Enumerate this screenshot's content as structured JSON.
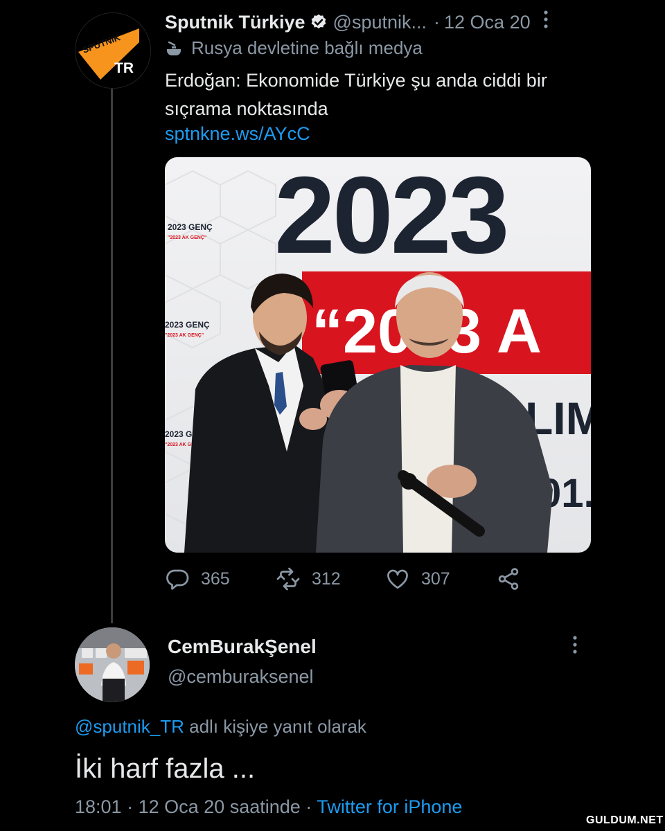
{
  "tweet": {
    "author_name": "Sputnik Türkiye",
    "handle": "@sputnik...",
    "separator": "·",
    "date": "12 Oca 20",
    "state_label": "Rusya devletine bağlı medya",
    "text": "Erdoğan: Ekonomide Türkiye şu anda ciddi bir sıçrama noktasında",
    "link": "sptnkne.ws/AYcC",
    "avatar": {
      "top_text": "SPUTNIK",
      "bottom_text": "TR",
      "accent": "#f7941d"
    },
    "image": {
      "banner_year": "2023",
      "banner_quote": "“2023 A",
      "banner_line3": "LIM",
      "banner_line4": "01.",
      "side_label_1": "2023 GENÇ",
      "side_label_2": "\"2023 AK GENÇ\"",
      "accent_red": "#d8141f",
      "text_dark": "#1d2431"
    },
    "stats": {
      "replies": "365",
      "retweets": "312",
      "likes": "307"
    },
    "icons": [
      "reply-icon",
      "retweet-icon",
      "like-icon",
      "share-icon"
    ]
  },
  "reply": {
    "author_name": "CemBurakŞenel",
    "handle": "@cemburaksenel",
    "replying_to_handle": "@sputnik_TR",
    "replying_to_suffix": "adlı kişiye yanıt olarak",
    "text": "İki harf fazla ...",
    "time": "18:01",
    "separator": "·",
    "date_suffix": "12 Oca 20 saatinde",
    "separator2": "·",
    "client": "Twitter for iPhone"
  },
  "watermark": "GULDUM.NET",
  "colors": {
    "background": "#000000",
    "text": "#e7e9ea",
    "muted": "#8b98a5",
    "link": "#1d9bf0",
    "verified": "#e7e9ea"
  }
}
